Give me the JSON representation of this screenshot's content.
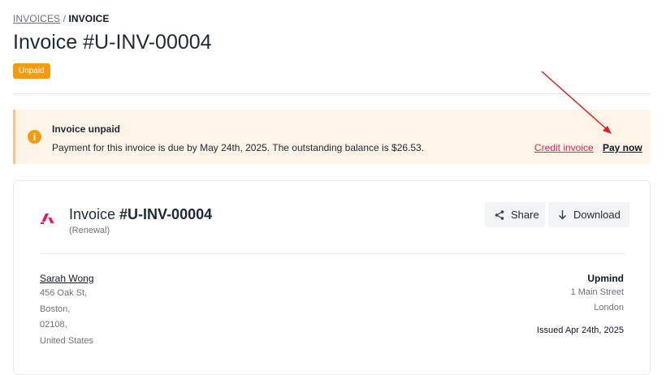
{
  "breadcrumb": {
    "parent": "INVOICES",
    "separator": " / ",
    "current": "INVOICE"
  },
  "page": {
    "title": "Invoice #U-INV-00004",
    "status_badge": "Unpaid"
  },
  "alert": {
    "title": "Invoice unpaid",
    "message": "Payment for this invoice is due by May 24th, 2025. The outstanding balance is $26.53.",
    "credit_label": "Credit invoice",
    "pay_label": "Pay now",
    "icon": "info-icon"
  },
  "invoice": {
    "title_prefix": "Invoice ",
    "number": "#U-INV-00004",
    "type": "(Renewal)",
    "share_label": "Share",
    "download_label": "Download"
  },
  "billed_to": {
    "name": "Sarah Wong",
    "address": [
      "456 Oak St,",
      "Boston,",
      "02108,",
      "United States"
    ]
  },
  "from": {
    "name": "Upmind",
    "address": [
      "1 Main Street",
      "London"
    ],
    "issued": "Issued Apr 24th, 2025"
  },
  "colors": {
    "badge": "#f39c12",
    "alert_bg": "#fdf3e6",
    "credit_link": "#e0245e",
    "logo": "#e8175d",
    "annotation_arrow": "#e02020"
  }
}
